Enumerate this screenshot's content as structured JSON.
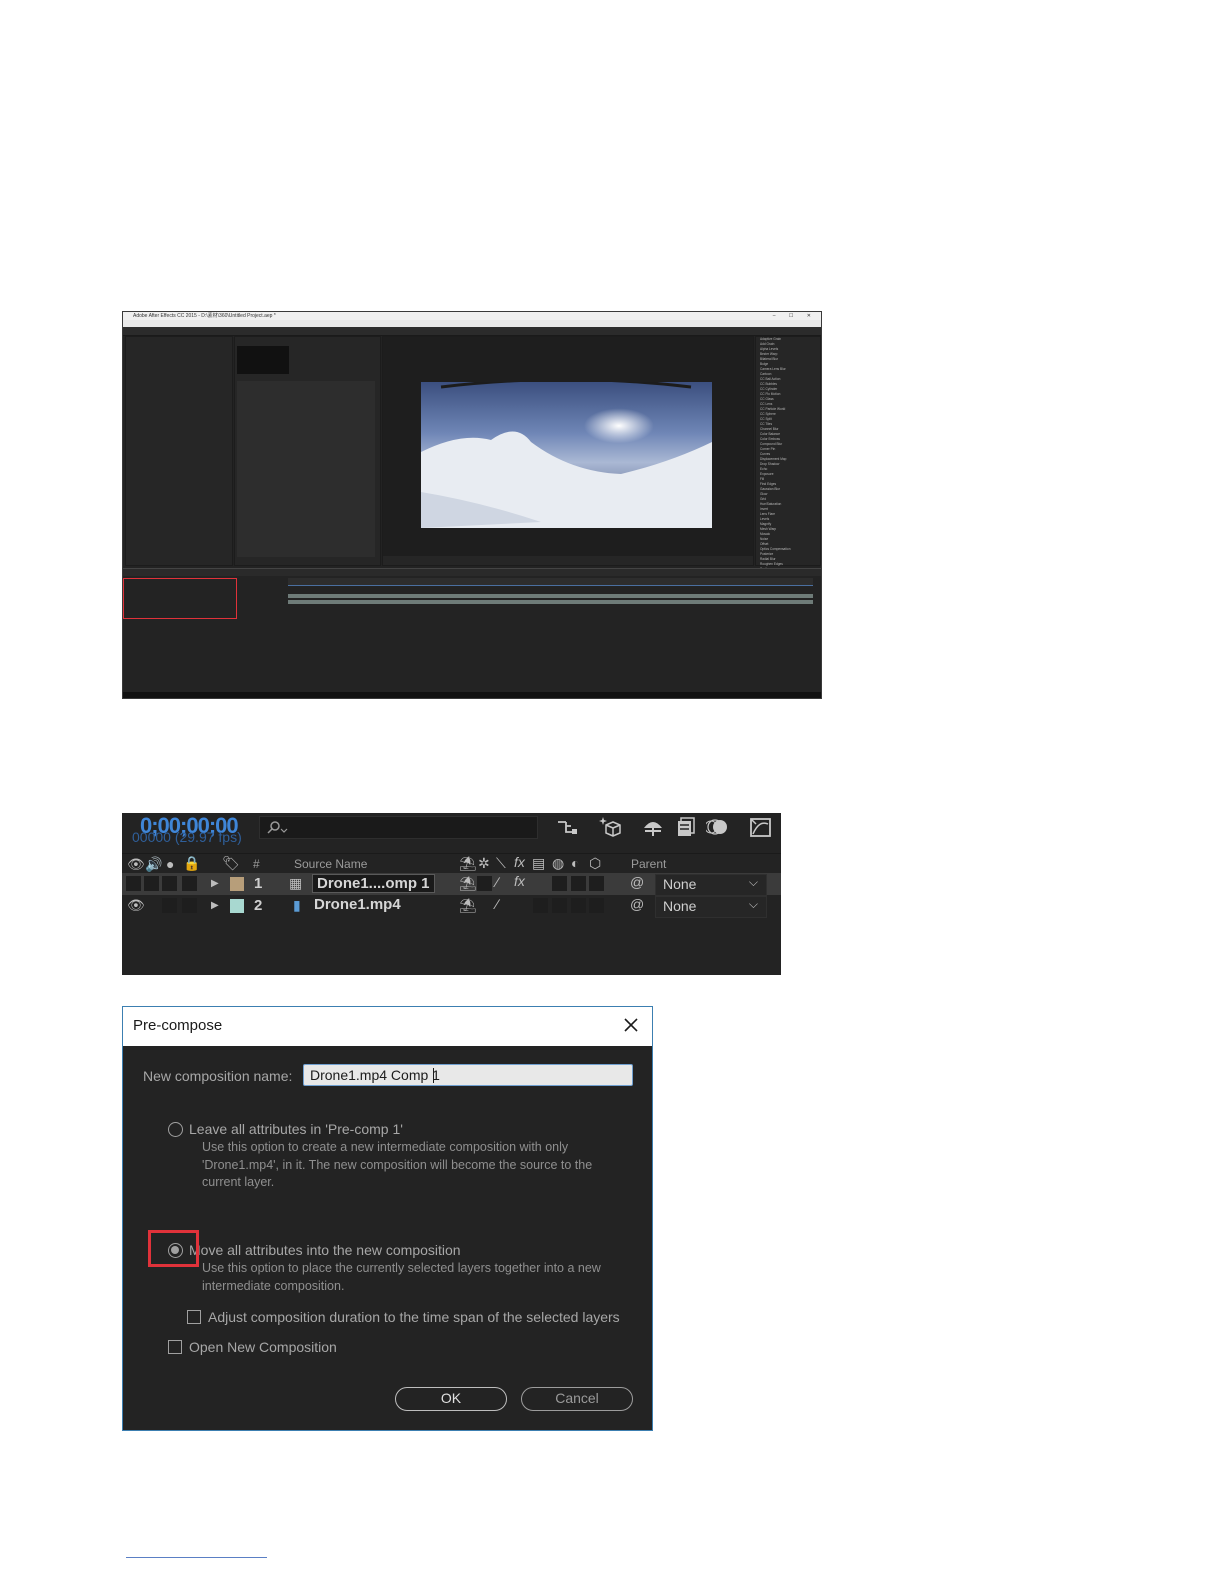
{
  "main_window": {
    "title": "Adobe After Effects CC 2015 - D:\\素材\\360\\Untitled Project.aep *",
    "menu": [
      "File",
      "Edit",
      "Composition",
      "Layer",
      "Effect",
      "Animation",
      "View",
      "Window",
      "Help"
    ],
    "effects_list": [
      "Adaptive Grain",
      "Add Grain",
      "Alpha Levels",
      "Bezier Warp",
      "Bilateral Blur",
      "Bulge",
      "Camera Lens Blur",
      "Cartoon",
      "CC Ball Action",
      "CC Bubbles",
      "CC Cylinder",
      "CC Flo Motion",
      "CC Glass",
      "CC Lens",
      "CC Particle World",
      "CC Sphere",
      "CC Split",
      "CC Tiles",
      "Channel Blur",
      "Color Balance",
      "Color Emboss",
      "Compound Blur",
      "Corner Pin",
      "Curves",
      "Displacement Map",
      "Drop Shadow",
      "Echo",
      "Exposure",
      "Fill",
      "Find Edges",
      "Gaussian Blur",
      "Glow",
      "Grid",
      "Hue/Saturation",
      "Invert",
      "Lens Flare",
      "Levels",
      "Magnify",
      "Mesh Warp",
      "Mosaic",
      "Noise",
      "Offset",
      "Optics Compensation",
      "Posterize",
      "Radial Blur",
      "Roughen Edges",
      "Scatter",
      "Sharpen",
      "Spherize",
      "Stroke",
      "Threshold",
      "Tint",
      "Transform",
      "Turbulent Displace",
      "Twirl",
      "Vegas",
      "Wave Warp"
    ]
  },
  "timeline_panel": {
    "timecode": "0;00;00;00",
    "frame_info": "00000 (29.97 fps)",
    "columns": {
      "hash": "#",
      "source_name": "Source Name",
      "parent": "Parent"
    },
    "layers": [
      {
        "number": "1",
        "name": "Drone1....omp 1",
        "label_color": "#b79e7a",
        "parent": "None",
        "selected": true
      },
      {
        "number": "2",
        "name": "Drone1.mp4",
        "label_color": "#a8d8d0",
        "parent": "None",
        "selected": false
      }
    ]
  },
  "precompose_dialog": {
    "title": "Pre-compose",
    "name_label": "New composition name:",
    "name_value": "Drone1.mp4 Comp 1",
    "option1_label": "Leave all attributes in 'Pre-comp 1'",
    "option1_desc": "Use this option to create a new intermediate composition with only 'Drone1.mp4', in it. The new composition will become the source to the current layer.",
    "option2_label": "Move all attributes into the new composition",
    "option2_desc": "Use this option to place the currently selected layers together into a new intermediate composition.",
    "adjust_duration_label": "Adjust composition duration to the time span of the selected layers",
    "open_new_label": "Open New Composition",
    "ok_label": "OK",
    "cancel_label": "Cancel",
    "selected_option": "move_all_attributes"
  }
}
